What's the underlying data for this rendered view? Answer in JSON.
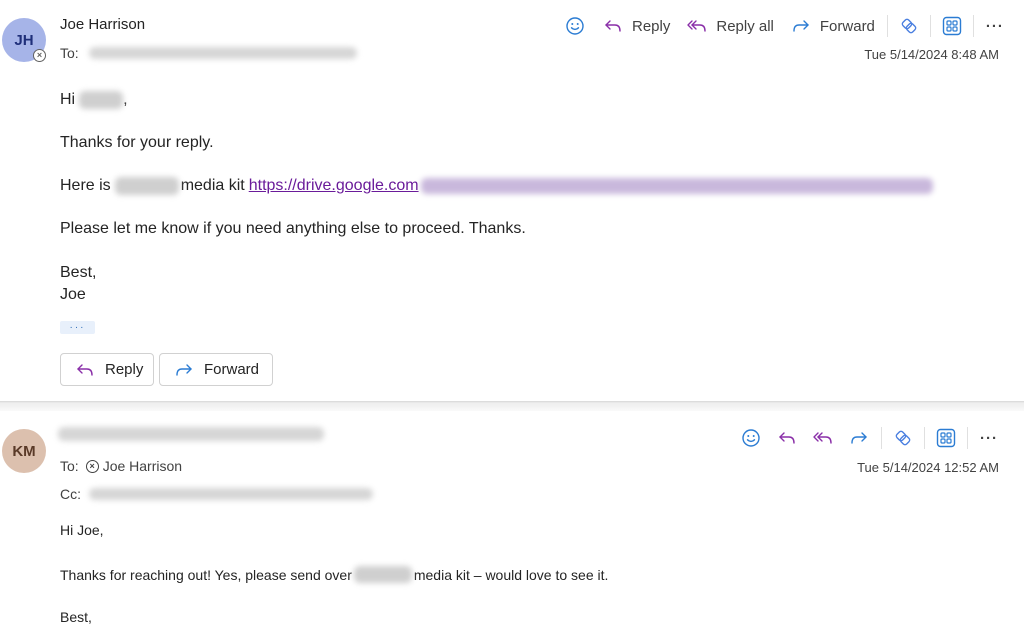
{
  "messages": [
    {
      "avatar": {
        "initials": "JH",
        "bg": "#a6b4e8",
        "fg": "#1f2f7a",
        "status": "blocked"
      },
      "sender": "Joe Harrison",
      "to_label": "To:",
      "to_value": "[redacted]",
      "timestamp": "Tue 5/14/2024 8:48 AM",
      "toolbar": {
        "emoji": "emoji-reaction",
        "reply": "Reply",
        "reply_all": "Reply all",
        "forward": "Forward",
        "loop": "loop-app",
        "apps": "apps",
        "more": "···"
      },
      "body": {
        "greeting_prefix": "Hi",
        "greeting_suffix": ",",
        "line1": "Thanks for your reply.",
        "line2_prefix": "Here is",
        "line2_middle": "media kit",
        "link": "https://drive.google.com",
        "line3": "Please let me know if you need anything else to proceed. Thanks.",
        "signoff": "Best,",
        "signature": "Joe"
      },
      "show_more": "···",
      "actions": {
        "reply": "Reply",
        "forward": "Forward"
      }
    },
    {
      "avatar": {
        "initials": "KM",
        "bg": "#dcc0ae",
        "fg": "#5a3a28"
      },
      "sender": "[redacted]",
      "to_label": "To:",
      "to_value": "Joe Harrison",
      "cc_label": "Cc:",
      "cc_value": "[redacted]",
      "timestamp": "Tue 5/14/2024 12:52 AM",
      "toolbar": {
        "more": "···"
      },
      "body": {
        "greeting": "Hi Joe,",
        "line1_prefix": "Thanks for reaching out! Yes, please send over",
        "line1_suffix": "media kit – would love to see it.",
        "signoff": "Best,"
      }
    }
  ],
  "colors": {
    "reply_icon": "#8a2fa8",
    "forward_icon": "#2b7cd3",
    "emoji_icon": "#2b7cd3",
    "link": "#6a1b9a"
  }
}
